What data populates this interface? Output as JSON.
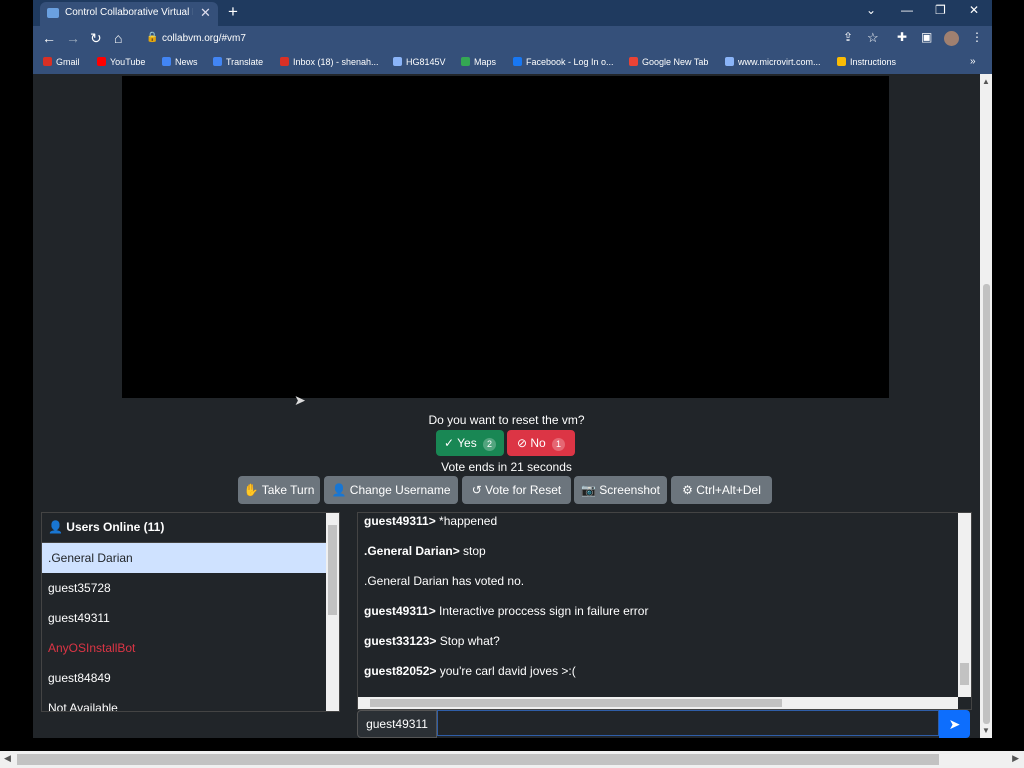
{
  "browser": {
    "tab_title": "Control Collaborative Virtual Ma",
    "url": "collabvm.org/#vm7",
    "bookmarks": [
      {
        "label": "Gmail",
        "color": "#d93025"
      },
      {
        "label": "YouTube",
        "color": "#ff0000"
      },
      {
        "label": "News",
        "color": "#4285f4"
      },
      {
        "label": "Translate",
        "color": "#4285f4"
      },
      {
        "label": "Inbox (18) - shenah...",
        "color": "#d93025"
      },
      {
        "label": "HG8145V",
        "color": "#8ab4f8"
      },
      {
        "label": "Maps",
        "color": "#34a853"
      },
      {
        "label": "Facebook - Log In o...",
        "color": "#1877f2"
      },
      {
        "label": "Google New Tab",
        "color": "#ea4335"
      },
      {
        "label": "www.microvirt.com...",
        "color": "#8ab4f8"
      },
      {
        "label": "Instructions",
        "color": "#fbbc04"
      }
    ]
  },
  "vote": {
    "question": "Do you want to reset the vm?",
    "yes_label": "Yes",
    "yes_count": "2",
    "no_label": "No",
    "no_count": "1",
    "ends_text": "Vote ends in 21 seconds"
  },
  "toolbar": {
    "take_turn": "Take Turn",
    "change_username": "Change Username",
    "vote_reset": "Vote for Reset",
    "screenshot": "Screenshot",
    "ctrl_alt_del": "Ctrl+Alt+Del"
  },
  "users": {
    "header": "Users Online (11)",
    "list": [
      {
        "name": ".General Darian",
        "color": "#212529",
        "selected": true
      },
      {
        "name": "guest35728",
        "color": "#ffffff"
      },
      {
        "name": "guest49311",
        "color": "#ffffff"
      },
      {
        "name": "AnyOSInstallBot",
        "color": "#dc3545"
      },
      {
        "name": "guest84849",
        "color": "#ffffff"
      },
      {
        "name": "Not Available",
        "color": "#ffffff"
      }
    ]
  },
  "chat": {
    "messages": [
      {
        "user": "guest49311>",
        "text": " *happened"
      },
      {
        "user": ".General Darian>",
        "text": " stop"
      },
      {
        "user": "",
        "text": ".General Darian has voted no."
      },
      {
        "user": "guest49311>",
        "text": " Interactive proccess sign in failure error"
      },
      {
        "user": "guest33123>",
        "text": " Stop what?"
      },
      {
        "user": "guest82052>",
        "text": " you're carl david joves >:("
      }
    ],
    "username": "guest49311",
    "input_value": ""
  }
}
